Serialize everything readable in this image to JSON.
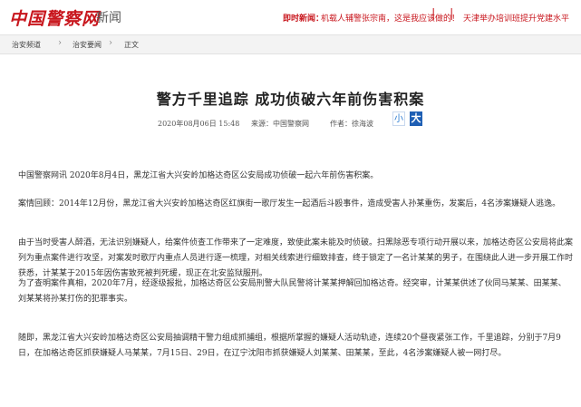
{
  "header": {
    "logo_text": "中国警察网",
    "section": "新闻",
    "ticker_label": "即时新闻：",
    "ticker_items": [
      "机载人辅警张宗南，这是我应该做的！",
      "天津举办培训班提升党建水平"
    ],
    "ticker_separator": "|",
    "brand_color": "#c8161d"
  },
  "breadcrumb": {
    "items": [
      "治安频道",
      "治安要闻",
      "正文"
    ],
    "separator": "›"
  },
  "article": {
    "title": "警方千里追踪 成功侦破六年前伤害积案",
    "date": "2020年08月06日 15:48",
    "source": "来源：中国警察网",
    "author": "作者：徐海波",
    "font_small": "小",
    "font_big": "大",
    "paragraphs": [
      "中国警察网讯 2020年8月4日，黑龙江省大兴安岭加格达奇区公安局成功侦破一起六年前伤害积案。",
      "案情回顾：2014年12月份，黑龙江省大兴安岭加格达奇区红旗街一歌厅发生一起酒后斗殴事件，造成受害人孙某重伤，发案后，4名涉案嫌疑人逃逸。",
      "由于当时受害人醉酒，无法识别嫌疑人，给案件侦查工作带来了一定难度，致使此案未能及时侦破。扫黑除恶专项行动开展以来，加格达奇区公安局将此案列为重点案件进行攻坚，对案发时歌厅内重点人员进行逐一梳理，对相关线索进行细致排查，终于锁定了一名计某某的男子，在围绕此人进一步开展工作时获悉，计某某于2015年因伤害致死被判死缓，现正在北安监狱服刑。",
      "为了查明案件真相，2020年7月，经逐级报批，加格达奇区公安局刑警大队民警将计某某押解回加格达奇。经突审，计某某供述了伙同马某某、田某某、刘某某将孙某打伤的犯罪事实。",
      "随即，黑龙江省大兴安岭加格达奇区公安局抽调精干警力组成抓捕组，根据所掌握的嫌疑人活动轨迹，连续20个昼夜紧张工作，千里追踪，分别于7月9日，在加格达奇区抓获嫌疑人马某某，7月15日、29日，在辽宁沈阳市抓获嫌疑人刘某某、田某某，至此，4名涉案嫌疑人被一网打尽。"
    ]
  },
  "colors": {
    "accent_blue": "#1e5fb4",
    "crumb_bg": "#f3f3f3"
  }
}
